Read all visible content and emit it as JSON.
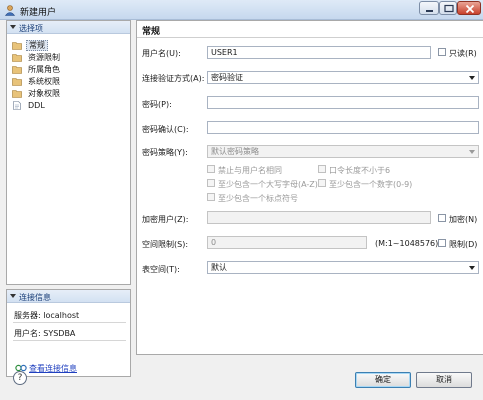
{
  "window": {
    "title": "新建用户"
  },
  "nav": {
    "header": "选择项",
    "items": [
      {
        "label": "常规",
        "selected": true
      },
      {
        "label": "资源限制",
        "selected": false
      },
      {
        "label": "所属角色",
        "selected": false
      },
      {
        "label": "系统权限",
        "selected": false
      },
      {
        "label": "对象权限",
        "selected": false
      },
      {
        "label": "DDL",
        "selected": false
      }
    ]
  },
  "conn": {
    "header": "连接信息",
    "server": "服务器: localhost",
    "user": "用户名: SYSDBA",
    "link": "查看连接信息"
  },
  "form": {
    "title": "常规",
    "username": {
      "label": "用户名(U):",
      "value": "USER1"
    },
    "readonly": {
      "label": "只读(R)",
      "checked": false
    },
    "auth": {
      "label": "连接验证方式(A):",
      "value": "密码验证"
    },
    "password": {
      "label": "密码(P):",
      "value": ""
    },
    "password_confirm": {
      "label": "密码确认(C):",
      "value": ""
    },
    "policy": {
      "label": "密码策略(Y):",
      "value": "默认密码策略",
      "options": [
        {
          "label": "禁止与用户名相同",
          "checked": false
        },
        {
          "label": "口令长度不小于6",
          "checked": false
        },
        {
          "label": "至少包含一个大写字母(A-Z)",
          "checked": false
        },
        {
          "label": "至少包含一个数字(0-9)",
          "checked": false
        },
        {
          "label": "至少包含一个标点符号",
          "checked": false
        }
      ]
    },
    "encrypt_user": {
      "label": "加密用户(Z):",
      "value": ""
    },
    "encrypt": {
      "label": "加密(N)",
      "checked": false
    },
    "space_limit": {
      "label": "空间限制(S):",
      "value": "0",
      "range": "(M:1~1048576)"
    },
    "limit": {
      "label": "限制(D)",
      "checked": false
    },
    "tablespace": {
      "label": "表空间(T):",
      "value": "默认"
    }
  },
  "buttons": {
    "ok": "确定",
    "cancel": "取消",
    "help": "?"
  },
  "colors": {
    "link": "#1f3fbf",
    "titlebar": "#c6d8ee",
    "close": "#c8412d"
  }
}
